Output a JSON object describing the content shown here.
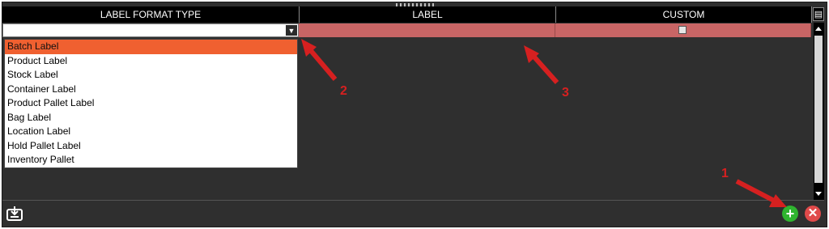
{
  "header": {
    "col1": "LABEL FORMAT TYPE",
    "col2": "LABEL",
    "col3": "CUSTOM",
    "corner_icon": "column-chooser-icon"
  },
  "row": {
    "label_format_type_value": "",
    "label_value": "",
    "custom_checked": false
  },
  "dropdown": {
    "items": [
      "Batch Label",
      "Product Label",
      "Stock Label",
      "Container Label",
      "Product Pallet Label",
      "Bag Label",
      "Location Label",
      "Hold Pallet Label",
      "Inventory Pallet"
    ],
    "selected_index": 0
  },
  "footer": {
    "export_icon": "export-icon",
    "add_icon": "plus-icon",
    "close_icon": "close-icon"
  },
  "annotations": {
    "n1": "1",
    "n2": "2",
    "n3": "3"
  },
  "colors": {
    "selected_item": "#f06030",
    "row_highlight": "#c86565",
    "arrow": "#d62020",
    "add_button": "#2fb52f",
    "close_button": "#e04a4a"
  }
}
